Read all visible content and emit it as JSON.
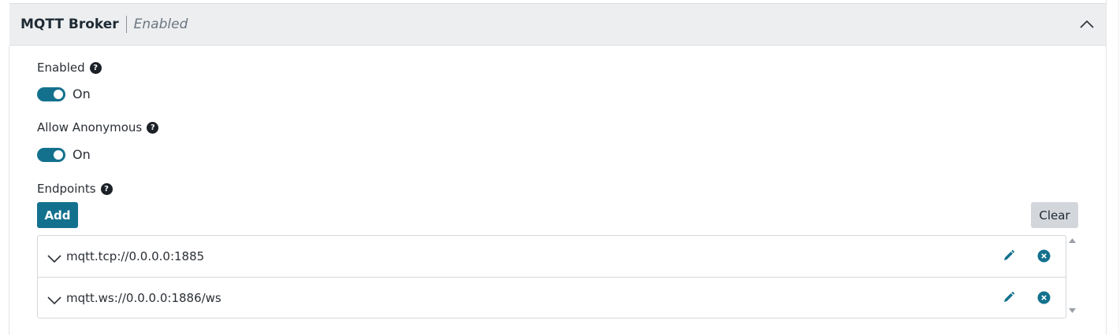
{
  "panel": {
    "title": "MQTT Broker",
    "status": "Enabled"
  },
  "fields": {
    "enabled": {
      "label": "Enabled",
      "help": "?",
      "toggle_text": "On"
    },
    "allow_anonymous": {
      "label": "Allow Anonymous",
      "help": "?",
      "toggle_text": "On"
    },
    "endpoints": {
      "label": "Endpoints",
      "help": "?"
    }
  },
  "buttons": {
    "add": "Add",
    "clear": "Clear"
  },
  "endpoints": [
    {
      "value": "mqtt.tcp://0.0.0.0:1885"
    },
    {
      "value": "mqtt.ws://0.0.0.0:1886/ws"
    }
  ],
  "icons": {
    "collapse": "chevron-up-icon",
    "expand_row": "chevron-down-icon",
    "edit": "pencil-icon",
    "remove": "close-circle-icon",
    "help": "question-circle-icon"
  },
  "colors": {
    "accent": "#13718e",
    "header_bg": "#eceef0",
    "clear_bg": "#d3d6da"
  }
}
